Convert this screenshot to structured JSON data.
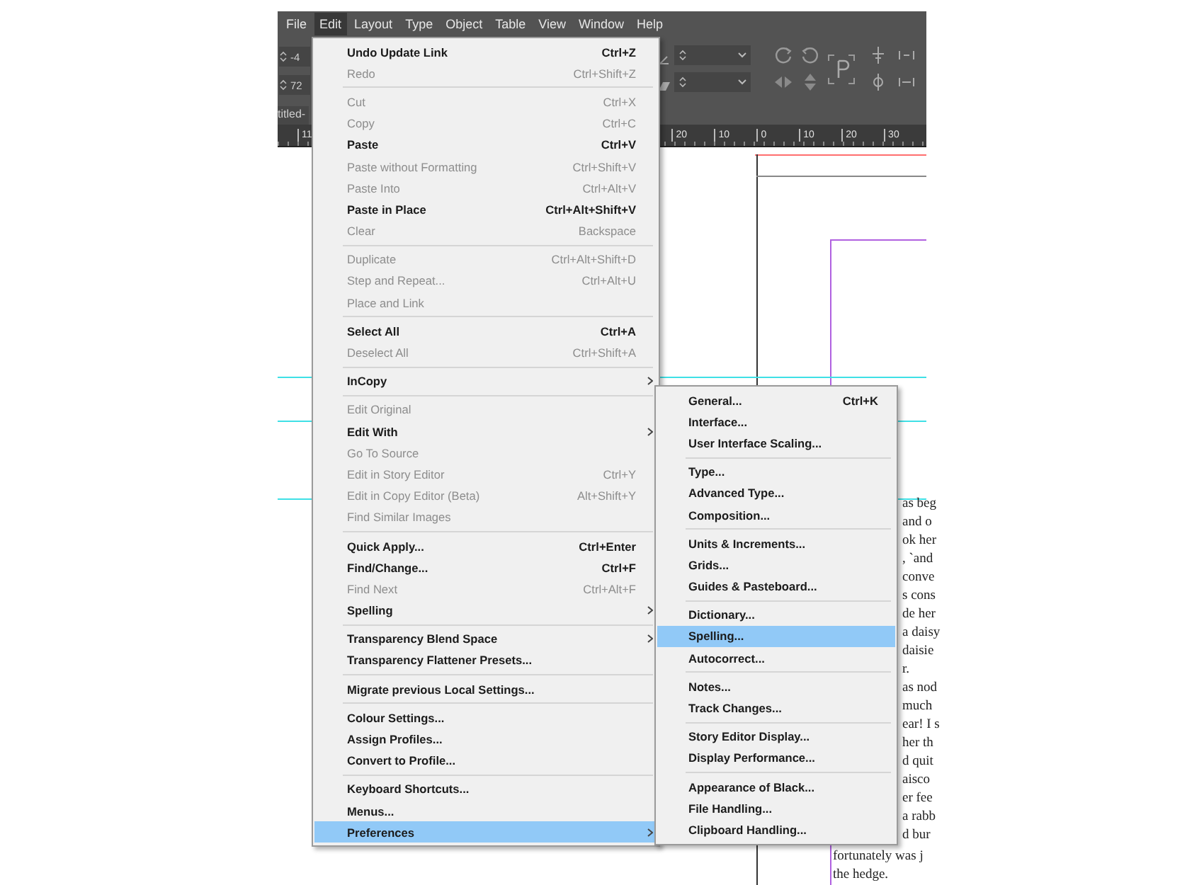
{
  "menu_bar": [
    {
      "label": "File",
      "selected": false
    },
    {
      "label": "Edit",
      "selected": true
    },
    {
      "label": "Layout",
      "selected": false
    },
    {
      "label": "Type",
      "selected": false
    },
    {
      "label": "Object",
      "selected": false
    },
    {
      "label": "Table",
      "selected": false
    },
    {
      "label": "View",
      "selected": false
    },
    {
      "label": "Window",
      "selected": false
    },
    {
      "label": "Help",
      "selected": false
    }
  ],
  "control_panel": {
    "fields": [
      "-4",
      "72"
    ]
  },
  "document_tab": "titled-",
  "ruler": {
    "labels": [
      "11",
      "20",
      "10",
      "0",
      "10",
      "20",
      "30"
    ]
  },
  "edit_menu": {
    "items": [
      {
        "kind": "item",
        "label": "Undo Update Link",
        "shortcut": "Ctrl+Z",
        "disabled": false,
        "submenu": false,
        "selected": false
      },
      {
        "kind": "item",
        "label": "Redo",
        "shortcut": "Ctrl+Shift+Z",
        "disabled": true,
        "submenu": false,
        "selected": false
      },
      {
        "kind": "separator"
      },
      {
        "kind": "item",
        "label": "Cut",
        "shortcut": "Ctrl+X",
        "disabled": true,
        "submenu": false,
        "selected": false
      },
      {
        "kind": "item",
        "label": "Copy",
        "shortcut": "Ctrl+C",
        "disabled": true,
        "submenu": false,
        "selected": false
      },
      {
        "kind": "item",
        "label": "Paste",
        "shortcut": "Ctrl+V",
        "disabled": false,
        "submenu": false,
        "selected": false
      },
      {
        "kind": "item",
        "label": "Paste without Formatting",
        "shortcut": "Ctrl+Shift+V",
        "disabled": true,
        "submenu": false,
        "selected": false
      },
      {
        "kind": "item",
        "label": "Paste Into",
        "shortcut": "Ctrl+Alt+V",
        "disabled": true,
        "submenu": false,
        "selected": false
      },
      {
        "kind": "item",
        "label": "Paste in Place",
        "shortcut": "Ctrl+Alt+Shift+V",
        "disabled": false,
        "submenu": false,
        "selected": false
      },
      {
        "kind": "item",
        "label": "Clear",
        "shortcut": "Backspace",
        "disabled": true,
        "submenu": false,
        "selected": false
      },
      {
        "kind": "separator"
      },
      {
        "kind": "item",
        "label": "Duplicate",
        "shortcut": "Ctrl+Alt+Shift+D",
        "disabled": true,
        "submenu": false,
        "selected": false
      },
      {
        "kind": "item",
        "label": "Step and Repeat...",
        "shortcut": "Ctrl+Alt+U",
        "disabled": true,
        "submenu": false,
        "selected": false
      },
      {
        "kind": "item",
        "label": "Place and Link",
        "disabled": true,
        "submenu": false,
        "selected": false
      },
      {
        "kind": "separator"
      },
      {
        "kind": "item",
        "label": "Select All",
        "shortcut": "Ctrl+A",
        "disabled": false,
        "submenu": false,
        "selected": false
      },
      {
        "kind": "item",
        "label": "Deselect All",
        "shortcut": "Ctrl+Shift+A",
        "disabled": true,
        "submenu": false,
        "selected": false
      },
      {
        "kind": "separator"
      },
      {
        "kind": "item",
        "label": "InCopy",
        "disabled": false,
        "submenu": true,
        "selected": false
      },
      {
        "kind": "separator"
      },
      {
        "kind": "item",
        "label": "Edit Original",
        "disabled": true,
        "submenu": false,
        "selected": false
      },
      {
        "kind": "item",
        "label": "Edit With",
        "disabled": false,
        "submenu": true,
        "selected": false
      },
      {
        "kind": "item",
        "label": "Go To Source",
        "disabled": true,
        "submenu": false,
        "selected": false
      },
      {
        "kind": "item",
        "label": "Edit in Story Editor",
        "shortcut": "Ctrl+Y",
        "disabled": true,
        "submenu": false,
        "selected": false
      },
      {
        "kind": "item",
        "label": "Edit in Copy Editor (Beta)",
        "shortcut": "Alt+Shift+Y",
        "disabled": true,
        "submenu": false,
        "selected": false
      },
      {
        "kind": "item",
        "label": "Find Similar Images",
        "disabled": true,
        "submenu": false,
        "selected": false
      },
      {
        "kind": "separator"
      },
      {
        "kind": "item",
        "label": "Quick Apply...",
        "shortcut": "Ctrl+Enter",
        "disabled": false,
        "submenu": false,
        "selected": false
      },
      {
        "kind": "item",
        "label": "Find/Change...",
        "shortcut": "Ctrl+F",
        "disabled": false,
        "submenu": false,
        "selected": false
      },
      {
        "kind": "item",
        "label": "Find Next",
        "shortcut": "Ctrl+Alt+F",
        "disabled": true,
        "submenu": false,
        "selected": false
      },
      {
        "kind": "item",
        "label": "Spelling",
        "disabled": false,
        "submenu": true,
        "selected": false
      },
      {
        "kind": "separator"
      },
      {
        "kind": "item",
        "label": "Transparency Blend Space",
        "disabled": false,
        "submenu": true,
        "selected": false
      },
      {
        "kind": "item",
        "label": "Transparency Flattener Presets...",
        "disabled": false,
        "submenu": false,
        "selected": false
      },
      {
        "kind": "separator"
      },
      {
        "kind": "item",
        "label": "Migrate previous Local Settings...",
        "disabled": false,
        "submenu": false,
        "selected": false
      },
      {
        "kind": "separator"
      },
      {
        "kind": "item",
        "label": "Colour Settings...",
        "disabled": false,
        "submenu": false,
        "selected": false
      },
      {
        "kind": "item",
        "label": "Assign Profiles...",
        "disabled": false,
        "submenu": false,
        "selected": false
      },
      {
        "kind": "item",
        "label": "Convert to Profile...",
        "disabled": false,
        "submenu": false,
        "selected": false
      },
      {
        "kind": "separator"
      },
      {
        "kind": "item",
        "label": "Keyboard Shortcuts...",
        "disabled": false,
        "submenu": false,
        "selected": false
      },
      {
        "kind": "item",
        "label": "Menus...",
        "disabled": false,
        "submenu": false,
        "selected": false
      },
      {
        "kind": "item",
        "label": "Preferences",
        "disabled": false,
        "submenu": true,
        "selected": true
      }
    ]
  },
  "preferences_submenu": {
    "items": [
      {
        "kind": "item",
        "label": "General...",
        "shortcut": "Ctrl+K",
        "selected": false
      },
      {
        "kind": "item",
        "label": "Interface...",
        "selected": false
      },
      {
        "kind": "item",
        "label": "User Interface Scaling...",
        "selected": false
      },
      {
        "kind": "separator"
      },
      {
        "kind": "item",
        "label": "Type...",
        "selected": false
      },
      {
        "kind": "item",
        "label": "Advanced Type...",
        "selected": false
      },
      {
        "kind": "item",
        "label": "Composition...",
        "selected": false
      },
      {
        "kind": "separator"
      },
      {
        "kind": "item",
        "label": "Units & Increments...",
        "selected": false
      },
      {
        "kind": "item",
        "label": "Grids...",
        "selected": false
      },
      {
        "kind": "item",
        "label": "Guides & Pasteboard...",
        "selected": false
      },
      {
        "kind": "separator"
      },
      {
        "kind": "item",
        "label": "Dictionary...",
        "selected": false
      },
      {
        "kind": "item",
        "label": "Spelling...",
        "selected": true
      },
      {
        "kind": "item",
        "label": "Autocorrect...",
        "selected": false
      },
      {
        "kind": "separator"
      },
      {
        "kind": "item",
        "label": "Notes...",
        "selected": false
      },
      {
        "kind": "item",
        "label": "Track Changes...",
        "selected": false
      },
      {
        "kind": "separator"
      },
      {
        "kind": "item",
        "label": "Story Editor Display...",
        "selected": false
      },
      {
        "kind": "item",
        "label": "Display Performance...",
        "selected": false
      },
      {
        "kind": "separator"
      },
      {
        "kind": "item",
        "label": "Appearance of Black...",
        "selected": false
      },
      {
        "kind": "item",
        "label": "File Handling...",
        "selected": false
      },
      {
        "kind": "item",
        "label": "Clipboard Handling...",
        "selected": false
      }
    ]
  },
  "document": {
    "text_fragments": [
      "as beg",
      "and o",
      "ok her",
      ", `and",
      "conve",
      "s cons",
      "de her",
      "a daisy",
      "daisie",
      "r.",
      "as nod",
      "much",
      "ear! I s",
      "her th",
      "d quit",
      "aisco",
      "er fee",
      "a rabb",
      "d bur"
    ],
    "text_lines": [
      "fortunately was j",
      "the hedge."
    ]
  }
}
